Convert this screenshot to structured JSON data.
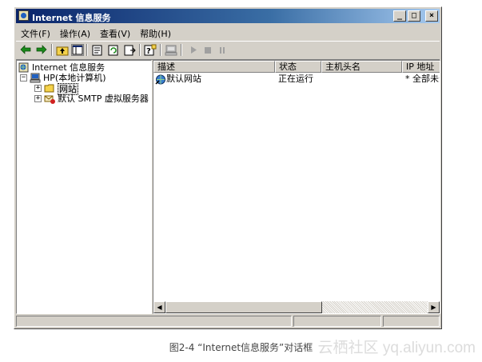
{
  "window": {
    "title": "Internet 信息服务",
    "controls": {
      "minimize": "_",
      "maximize": "□",
      "close": "×"
    }
  },
  "menu": [
    {
      "label": "文件(F)"
    },
    {
      "label": "操作(A)"
    },
    {
      "label": "查看(V)"
    },
    {
      "label": "帮助(H)"
    }
  ],
  "toolbar": {
    "icons": [
      "back-icon",
      "forward-icon",
      "up-folder-icon",
      "show-tree-icon",
      "properties-icon",
      "refresh-icon",
      "export-list-icon",
      "help-icon",
      "computer-icon",
      "start-icon",
      "stop-icon",
      "pause-icon"
    ]
  },
  "tree": {
    "root": "Internet 信息服务",
    "computer": "HP(本地计算机)",
    "websites": "网站",
    "smtp": "默认 SMTP 虚拟服务器"
  },
  "list": {
    "columns": [
      "描述",
      "状态",
      "主机头名",
      "IP 地址"
    ],
    "rows": [
      {
        "description": "默认网站",
        "status": "正在运行",
        "host": "",
        "ip": "* 全部未分"
      }
    ]
  },
  "caption": "图2-4    “Internet信息服务”对话框",
  "watermark": "云栖社区 yq.aliyun.com",
  "colors": {
    "titlebar_start": "#0a246a",
    "titlebar_end": "#a6caf0",
    "face": "#d4d0c8"
  }
}
